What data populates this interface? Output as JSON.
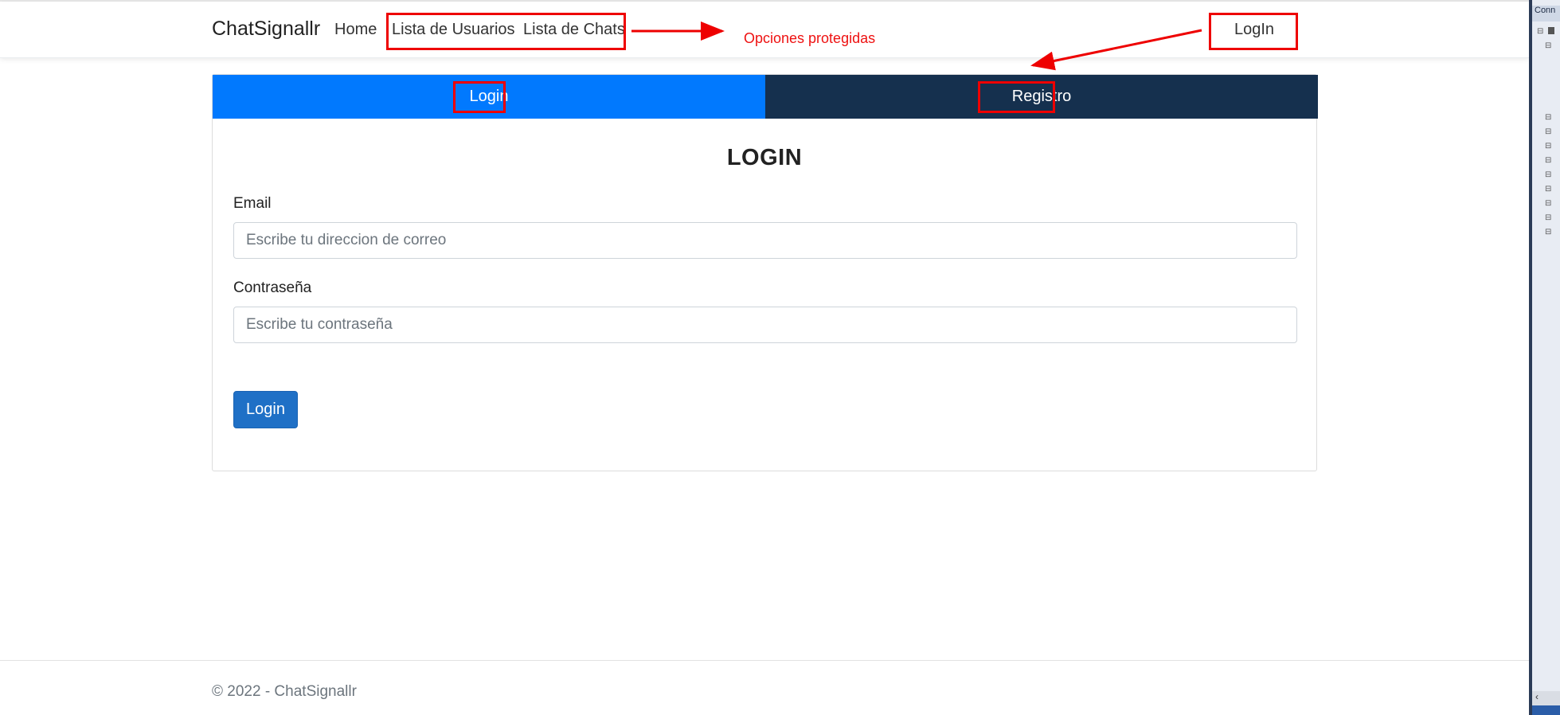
{
  "navbar": {
    "brand": "ChatSignallr",
    "links": [
      {
        "label": "Home"
      },
      {
        "label": "Lista de Usuarios"
      },
      {
        "label": "Lista de Chats"
      }
    ],
    "login_link": "LogIn"
  },
  "annotations": {
    "protected_options_note": "Opciones protegidas",
    "color": "#ee0000"
  },
  "tabs": [
    {
      "label": "Login",
      "active": true,
      "color": "#0179fe"
    },
    {
      "label": "Registro",
      "active": false,
      "color": "#15304e"
    }
  ],
  "form": {
    "title": "LOGIN",
    "email_label": "Email",
    "email_placeholder": "Escribe tu direccion de correo",
    "email_value": "",
    "password_label": "Contraseña",
    "password_placeholder": "Escribe tu contraseña",
    "password_value": "",
    "submit_label": "Login",
    "submit_color": "#1f70c6"
  },
  "footer": {
    "text": "© 2022 - ChatSignallr"
  },
  "ide_panel": {
    "header": "Conn",
    "scroll_left": "‹"
  }
}
